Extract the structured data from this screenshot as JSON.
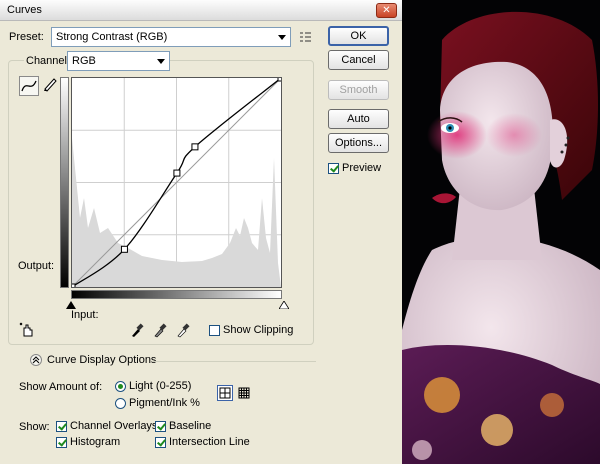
{
  "window": {
    "title": "Curves",
    "close_glyph": "✕"
  },
  "preset": {
    "label": "Preset:",
    "value": "Strong Contrast (RGB)"
  },
  "channel": {
    "label": "Channel:",
    "value": "RGB"
  },
  "curve": {
    "points": [
      [
        0,
        0
      ],
      [
        64,
        46
      ],
      [
        128,
        139
      ],
      [
        150,
        171
      ],
      [
        255,
        255
      ]
    ],
    "histogram_color": "#d9d9d9",
    "curve_color": "#000000"
  },
  "labels": {
    "output": "Output:",
    "input": "Input:",
    "show_clipping": "Show Clipping",
    "curve_display_options": "Curve Display Options",
    "show_amount_of": "Show Amount of:",
    "light": "Light  (0-255)",
    "pigment": "Pigment/Ink %",
    "show": "Show:",
    "channel_overlays": "Channel Overlays",
    "baseline": "Baseline",
    "histogram": "Histogram",
    "intersection_line": "Intersection Line"
  },
  "buttons": {
    "ok": "OK",
    "cancel": "Cancel",
    "smooth": "Smooth",
    "auto": "Auto",
    "options": "Options...",
    "preview": "Preview"
  },
  "state": {
    "preview": true,
    "show_clipping": false,
    "light_selected": true,
    "channel_overlays": true,
    "baseline": true,
    "histogram": true,
    "intersection_line": true
  },
  "colors": {
    "dialog_bg": "#ece9d8",
    "accent": "#3b63a8"
  }
}
